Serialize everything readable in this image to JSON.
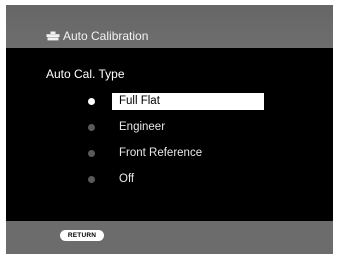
{
  "header": {
    "icon": "calibration-icon",
    "title": "Auto Calibration"
  },
  "main": {
    "section_label": "Auto Cal. Type",
    "options": [
      {
        "label": "Full Flat",
        "selected": true
      },
      {
        "label": "Engineer",
        "selected": false
      },
      {
        "label": "Front Reference",
        "selected": false
      },
      {
        "label": "Off",
        "selected": false
      }
    ]
  },
  "footer": {
    "return_label": "RETURN"
  },
  "colors": {
    "panel": "#6a6a6a",
    "body": "#000000",
    "highlight": "#ffffff",
    "dot_inactive": "#5a5a5a"
  }
}
